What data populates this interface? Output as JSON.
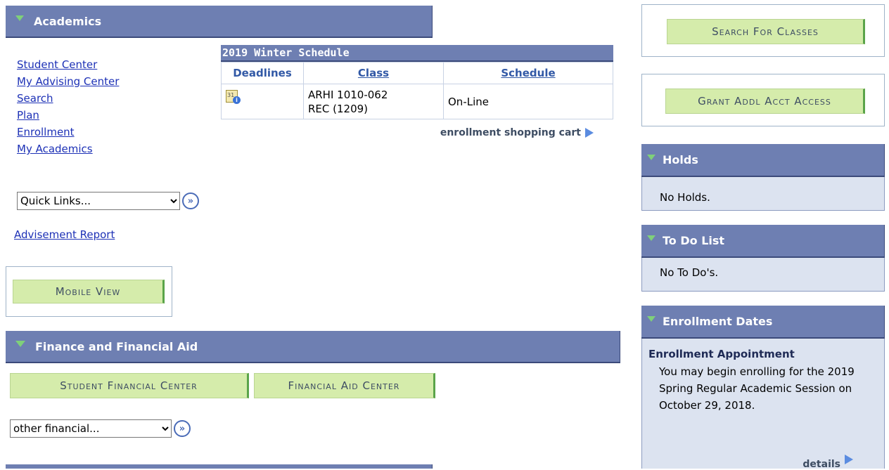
{
  "academics": {
    "header": "Academics",
    "nav": [
      "Student Center",
      "My Advising Center",
      "Search",
      "Plan",
      "Enrollment",
      "My Academics"
    ],
    "quick_links": "Quick Links...",
    "advisement_report": "Advisement Report",
    "mobile_view": "Mobile View"
  },
  "schedule": {
    "title": "2019 Winter Schedule",
    "headers": [
      "Deadlines",
      "Class",
      "Schedule"
    ],
    "rows": [
      {
        "class_line1": "ARHI 1010-062",
        "class_line2": "REC (1209)",
        "schedule": "On-Line"
      }
    ],
    "cart_link": "enrollment shopping cart"
  },
  "finance": {
    "header": "Finance and Financial Aid",
    "student_financial_center": "Student Financial Center",
    "financial_aid_center": "Financial Aid Center",
    "other_financial": "other financial..."
  },
  "right": {
    "search_for_classes": "Search For Classes",
    "grant_access": "Grant Addl Acct Access",
    "holds": {
      "header": "Holds",
      "text": "No Holds."
    },
    "todo": {
      "header": "To Do List",
      "text": "No To Do's."
    },
    "enrollment_dates": {
      "header": "Enrollment Dates",
      "subheader": "Enrollment Appointment",
      "text": "You may begin enrolling for the 2019 Spring Regular Academic Session on October 29, 2018.",
      "details": "details"
    }
  },
  "colors": {
    "header_bg": "#6e7fb2",
    "button_bg": "#d5ecab",
    "link": "#1d31b6",
    "panel_bg": "#dce3f0"
  }
}
